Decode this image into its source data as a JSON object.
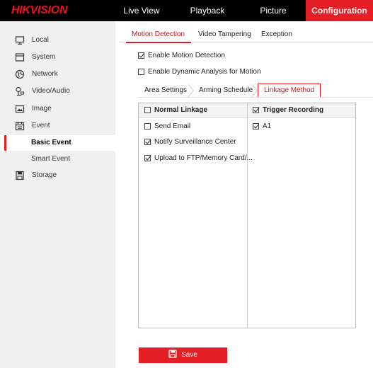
{
  "brand": {
    "logo_text": "HIKVISION"
  },
  "nav": {
    "live_view": "Live View",
    "playback": "Playback",
    "picture": "Picture",
    "configuration": "Configuration"
  },
  "sidebar": {
    "items": [
      {
        "label": "Local",
        "icon": "monitor-icon"
      },
      {
        "label": "System",
        "icon": "system-icon"
      },
      {
        "label": "Network",
        "icon": "globe-icon"
      },
      {
        "label": "Video/Audio",
        "icon": "video-audio-icon"
      },
      {
        "label": "Image",
        "icon": "image-icon"
      },
      {
        "label": "Event",
        "icon": "calendar-icon"
      }
    ],
    "sub_items": [
      {
        "label": "Basic Event",
        "active": true
      },
      {
        "label": "Smart Event",
        "active": false
      }
    ],
    "storage": {
      "label": "Storage",
      "icon": "storage-icon"
    }
  },
  "tabs": {
    "motion_detection": "Motion Detection",
    "video_tampering": "Video Tampering",
    "exception": "Exception"
  },
  "options": {
    "enable_motion": {
      "label": "Enable Motion Detection",
      "checked": true
    },
    "dynamic_analysis": {
      "label": "Enable Dynamic Analysis for Motion",
      "checked": false
    }
  },
  "subtabs": {
    "area_settings": "Area Settings",
    "arming_schedule": "Arming Schedule",
    "linkage_method": "Linkage Method"
  },
  "linkage": {
    "normal_header": {
      "label": "Normal Linkage",
      "checked": false
    },
    "trigger_header": {
      "label": "Trigger Recording",
      "checked": true
    },
    "normal_items": [
      {
        "label": "Send Email",
        "checked": false
      },
      {
        "label": "Notify Surveillance Center",
        "checked": true
      },
      {
        "label": "Upload to FTP/Memory Card/...",
        "checked": true
      }
    ],
    "trigger_items": [
      {
        "label": "A1",
        "checked": true
      }
    ]
  },
  "actions": {
    "save": "Save"
  },
  "colors": {
    "accent": "#e31e24",
    "topbar": "#000000",
    "sidebar": "#f0f0f0"
  }
}
